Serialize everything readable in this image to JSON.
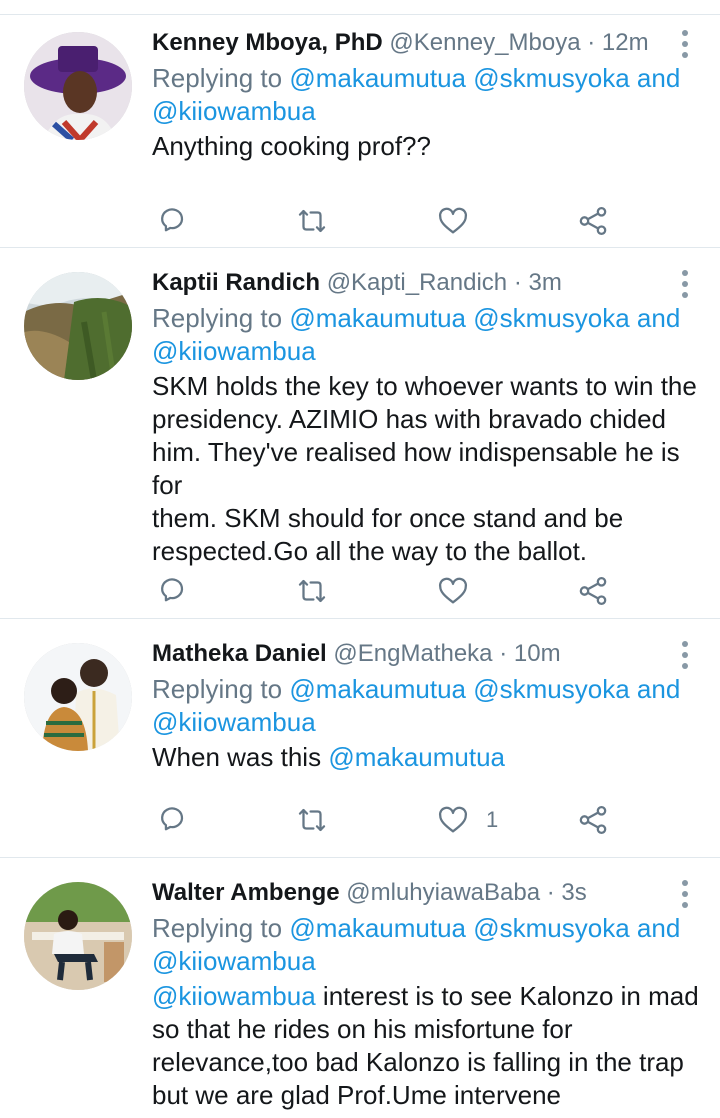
{
  "tweets": [
    {
      "name": "Kenney Mboya, PhD",
      "handle": "@Kenney_Mboya",
      "sep": "·",
      "time": "12m",
      "replying_prefix": "Replying to",
      "reply_to_1": "@makaumutua",
      "reply_to_2": "@skmusyoka",
      "reply_and": "and",
      "reply_to_3": "@kiiowambua",
      "text": "Anything cooking prof??",
      "like_count": ""
    },
    {
      "name": "Kaptii Randich",
      "handle": "@Kapti_Randich",
      "sep": "·",
      "time": "3m",
      "replying_prefix": "Replying to",
      "reply_to_1": "@makaumutua",
      "reply_to_2": "@skmusyoka",
      "reply_and": "and",
      "reply_to_3": "@kiiowambua",
      "text_lines": [
        "SKM holds the key to whoever wants to win the",
        "presidency. AZIMIO has with bravado chided",
        "him. They've realised how indispensable he is for",
        "them. SKM should for once stand and be",
        "respected.Go all the way to the ballot."
      ],
      "like_count": ""
    },
    {
      "name": "Matheka Daniel",
      "handle": "@EngMatheka",
      "sep": "·",
      "time": "10m",
      "replying_prefix": "Replying to",
      "reply_to_1": "@makaumutua",
      "reply_to_2": "@skmusyoka",
      "reply_and": "and",
      "reply_to_3": "@kiiowambua",
      "text_prefix": "When was this",
      "text_mention": "@makaumutua",
      "like_count": "1"
    },
    {
      "name": "Walter Ambenge",
      "handle": "@mluhyiawaBaba",
      "sep": "·",
      "time": "3s",
      "replying_prefix": "Replying to",
      "reply_to_1": "@makaumutua",
      "reply_to_2": "@skmusyoka",
      "reply_and": "and",
      "reply_to_3": "@kiiowambua",
      "text_mention": "@kiiowambua",
      "text_line1_rest": "interest is to see Kalonzo in mad",
      "text_lines": [
        "so that he rides on his misfortune for",
        "relevance,too bad Kalonzo is falling in the trap",
        "but we are glad Prof.Ume intervene"
      ]
    }
  ],
  "icons": {
    "reply": "reply-icon",
    "retweet": "retweet-icon",
    "like": "heart-icon",
    "share": "share-icon",
    "more": "more-vertical-icon"
  },
  "colors": {
    "link": "#1b95e0",
    "secondary_text": "#657786",
    "icon": "#657786",
    "divider": "#e1e8ed"
  }
}
